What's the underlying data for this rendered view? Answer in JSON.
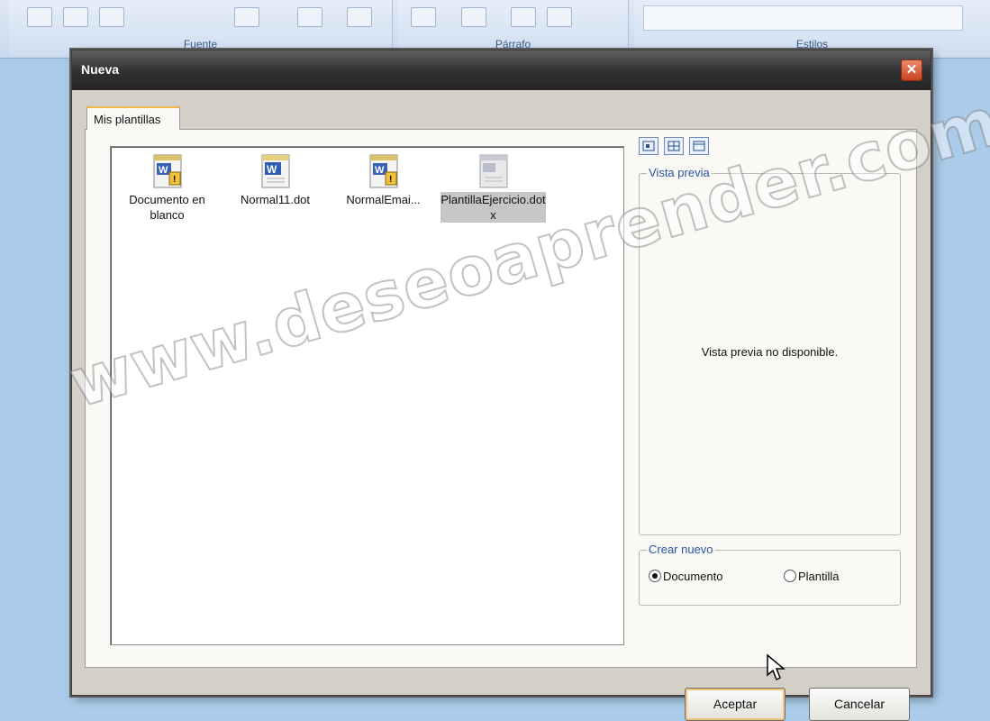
{
  "ribbon": {
    "groups": [
      "Fuente",
      "Párrafo",
      "Estilos"
    ]
  },
  "dialog": {
    "title": "Nueva",
    "close_glyph": "✕",
    "tab_label": "Mis plantillas",
    "files": [
      {
        "label": "Documento en blanco",
        "icon": "word-template-icon",
        "selected": false
      },
      {
        "label": "Normal11.dot",
        "icon": "word-document-icon",
        "selected": false
      },
      {
        "label": "NormalEmai...",
        "icon": "word-template-icon",
        "selected": false
      },
      {
        "label": "PlantillaEjercicio.dotx",
        "icon": "generic-template-icon",
        "selected": true
      }
    ],
    "preview": {
      "legend": "Vista previa",
      "message": "Vista previa no disponible."
    },
    "create_new": {
      "legend": "Crear nuevo",
      "options": [
        "Documento",
        "Plantilla"
      ],
      "selected": "Documento"
    },
    "buttons": {
      "ok": "Aceptar",
      "cancel": "Cancelar"
    }
  },
  "watermark": "www.deseoaprender.com",
  "colors": {
    "accent_tab": "#f1b74c",
    "legend_text": "#2b55a1",
    "close_button": "#c9431f"
  }
}
